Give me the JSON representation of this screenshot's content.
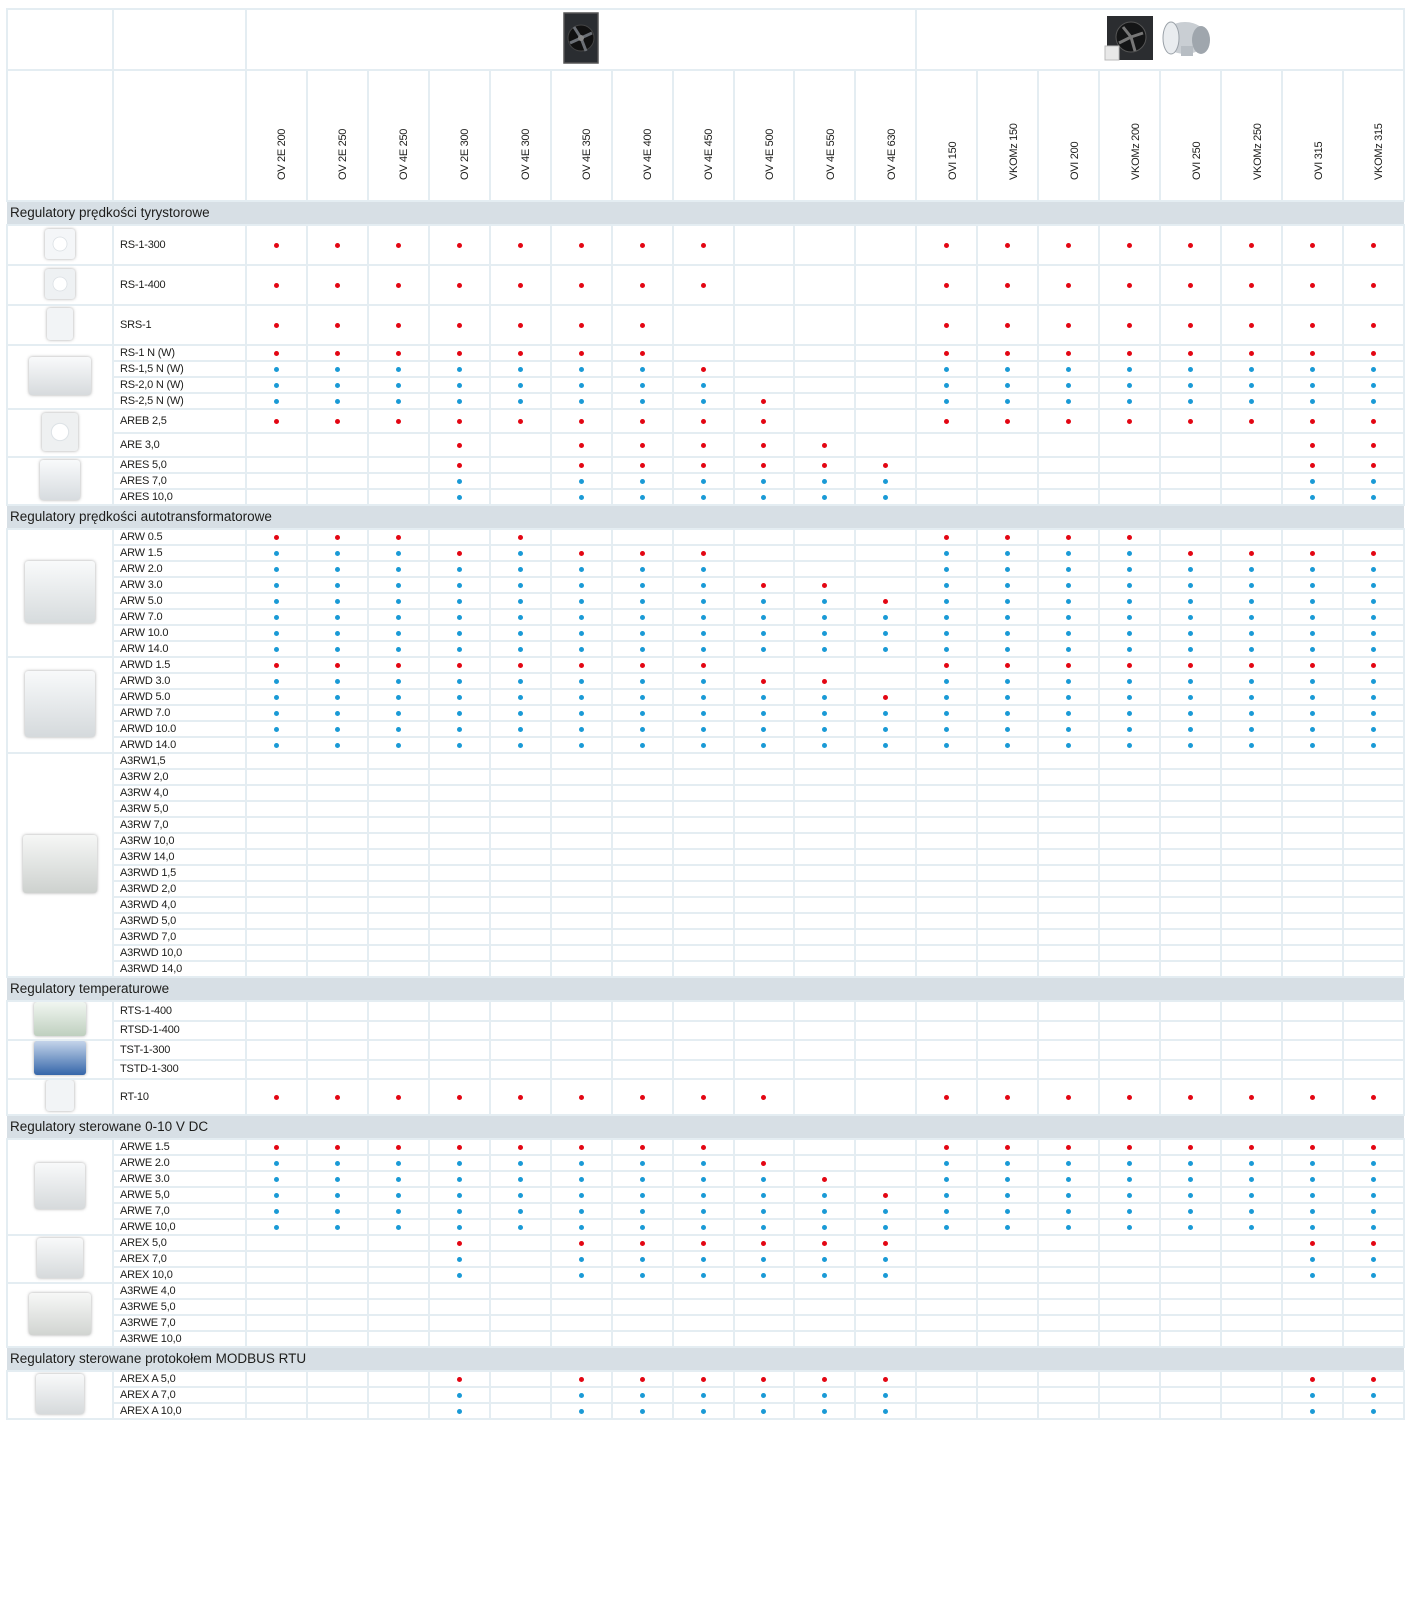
{
  "columns": [
    "OV 2E 200",
    "OV 2E 250",
    "OV 4E 250",
    "OV 2E 300",
    "OV 4E 300",
    "OV 4E 350",
    "OV 4E 400",
    "OV 4E 450",
    "OV 4E 500",
    "OV 4E 550",
    "OV 4E 630",
    "OVI 150",
    "VKOMz 150",
    "OVI 200",
    "VKOMz 200",
    "OVI 250",
    "VKOMz 250",
    "OVI 315",
    "VKOMz 315"
  ],
  "header_images": [
    {
      "icon": "wall-fan-image",
      "span": 11
    },
    {
      "icon": "inline-fan-image",
      "span": 8
    }
  ],
  "colors": {
    "red": "#e30613",
    "blue": "#1a9ad6",
    "section_bg": "#d7dfe5",
    "grid": "#e4edf2"
  },
  "sections": [
    {
      "title": "Regulatory prędkości tyrystorowe",
      "groups": [
        {
          "icon": "rs-1-300-controller-image",
          "rowh": 40,
          "rows": [
            {
              "name": "RS-1-300",
              "pattern": "RRRRRRRR---RRRRRRRR"
            }
          ]
        },
        {
          "icon": "rs-1-400-controller-image",
          "rowh": 40,
          "rows": [
            {
              "name": "RS-1-400",
              "pattern": "RRRRRRRR---RRRRRRRR"
            }
          ]
        },
        {
          "icon": "srs-1-controller-image",
          "rowh": 40,
          "rows": [
            {
              "name": "SRS-1",
              "pattern": "RRRRRRR----RRRRRRRR"
            }
          ]
        },
        {
          "icon": "rs-n-controller-image",
          "rowh": 16,
          "rows": [
            {
              "name": "RS-1 N (W)",
              "pattern": "RRRRRRR----RRRRRRRR"
            },
            {
              "name": "RS-1,5 N (W)",
              "pattern": "BBBBBBBR---BBBBBBBB"
            },
            {
              "name": "RS-2,0 N (W)",
              "pattern": "BBBBBBBB---BBBBBBBB"
            },
            {
              "name": "RS-2,5 N (W)",
              "pattern": "BBBBBBBBR--BBBBBBBB"
            }
          ]
        },
        {
          "icon": "areb-controller-image",
          "rowh": 24,
          "rows": [
            {
              "name": "AREB 2,5",
              "pattern": "RRRRRRRRR--RRRRRRRR"
            },
            {
              "name": "ARE 3,0",
              "pattern": "---R-RRRRR-------RR"
            }
          ]
        },
        {
          "icon": "ares-controller-image",
          "rowh": 16,
          "rows": [
            {
              "name": "ARES 5,0",
              "pattern": "---R-RRRRRR------RR"
            },
            {
              "name": "ARES 7,0",
              "pattern": "---B-BBBBBB------BB"
            },
            {
              "name": "ARES 10,0",
              "pattern": "---B-BBBBBB------BB"
            }
          ]
        }
      ]
    },
    {
      "title": "Regulatory prędkości autotransformatorowe",
      "groups": [
        {
          "icon": "arw-controller-image",
          "rowh": 16,
          "rows": [
            {
              "name": "ARW 0.5",
              "pattern": "RRR-R------RRRR----"
            },
            {
              "name": "ARW 1.5",
              "pattern": "BBBRBRRR---BBBBRRRR"
            },
            {
              "name": "ARW 2.0",
              "pattern": "BBBBBBBB---BBBBBBBB"
            },
            {
              "name": "ARW 3.0",
              "pattern": "BBBBBBBBRR-BBBBBBBB"
            },
            {
              "name": "ARW 5.0",
              "pattern": "BBBBBBBBBBRBBBBBBBB"
            },
            {
              "name": "ARW 7.0",
              "pattern": "BBBBBBBBBBBBBBBBBBB"
            },
            {
              "name": "ARW 10.0",
              "pattern": "BBBBBBBBBBBBBBBBBBB"
            },
            {
              "name": "ARW 14.0",
              "pattern": "BBBBBBBBBBBBBBBBBBB"
            }
          ]
        },
        {
          "icon": "arwd-controller-image",
          "rowh": 16,
          "rows": [
            {
              "name": "ARWD 1.5",
              "pattern": "RRRRRRRR---RRRRRRRR"
            },
            {
              "name": "ARWD 3.0",
              "pattern": "BBBBBBBBRR-BBBBBBBB"
            },
            {
              "name": "ARWD 5.0",
              "pattern": "BBBBBBBBBBRBBBBBBBB"
            },
            {
              "name": "ARWD 7.0",
              "pattern": "BBBBBBBBBBBBBBBBBBB"
            },
            {
              "name": "ARWD 10.0",
              "pattern": "BBBBBBBBBBBBBBBBBBB"
            },
            {
              "name": "ARWD 14.0",
              "pattern": "BBBBBBBBBBBBBBBBBBB"
            }
          ]
        },
        {
          "icon": "a3rw-controller-image",
          "rowh": 16,
          "rows": [
            {
              "name": "A3RW1,5",
              "pattern": "-------------------"
            },
            {
              "name": "A3RW 2,0",
              "pattern": "-------------------"
            },
            {
              "name": "A3RW 4,0",
              "pattern": "-------------------"
            },
            {
              "name": "A3RW 5,0",
              "pattern": "-------------------"
            },
            {
              "name": "A3RW 7,0",
              "pattern": "-------------------"
            },
            {
              "name": "A3RW 10,0",
              "pattern": "-------------------"
            },
            {
              "name": "A3RW 14,0",
              "pattern": "-------------------"
            },
            {
              "name": "A3RWD 1,5",
              "pattern": "-------------------"
            },
            {
              "name": "A3RWD 2,0",
              "pattern": "-------------------"
            },
            {
              "name": "A3RWD 4,0",
              "pattern": "-------------------"
            },
            {
              "name": "A3RWD 5,0",
              "pattern": "-------------------"
            },
            {
              "name": "A3RWD 7,0",
              "pattern": "-------------------"
            },
            {
              "name": "A3RWD 10,0",
              "pattern": "-------------------"
            },
            {
              "name": "A3RWD 14,0",
              "pattern": "-------------------"
            }
          ]
        }
      ]
    },
    {
      "title": "Regulatory temperaturowe",
      "groups": [
        {
          "icon": "rts-controller-image",
          "rowh": 19,
          "rows": [
            {
              "name": "RTS-1-400",
              "pattern": "-------------------"
            },
            {
              "name": "RTSD-1-400",
              "pattern": "-------------------"
            }
          ]
        },
        {
          "icon": "tst-controller-image",
          "rowh": 19,
          "rows": [
            {
              "name": "TST-1-300",
              "pattern": "-------------------"
            },
            {
              "name": "TSTD-1-300",
              "pattern": "-------------------"
            }
          ]
        },
        {
          "icon": "rt-10-controller-image",
          "rowh": 35,
          "rows": [
            {
              "name": "RT-10",
              "pattern": "RRRRRRRRR--RRRRRRRR"
            }
          ]
        }
      ]
    },
    {
      "title": "Regulatory sterowane 0-10 V DC",
      "groups": [
        {
          "icon": "arwe-controller-image",
          "rowh": 16,
          "rows": [
            {
              "name": "ARWE 1.5",
              "pattern": "RRRRRRRR---RRRRRRRR"
            },
            {
              "name": "ARWE 2.0",
              "pattern": "BBBBBBBBR--BBBBBBBB"
            },
            {
              "name": "ARWE 3.0",
              "pattern": "BBBBBBBBBR-BBBBBBBB"
            },
            {
              "name": "ARWE 5,0",
              "pattern": "BBBBBBBBBBRBBBBBBBB"
            },
            {
              "name": "ARWE 7,0",
              "pattern": "BBBBBBBBBBBBBBBBBBB"
            },
            {
              "name": "ARWE 10,0",
              "pattern": "BBBBBBBBBBBBBBBBBBB"
            }
          ]
        },
        {
          "icon": "arex-controller-image",
          "rowh": 16,
          "rows": [
            {
              "name": "AREX 5,0",
              "pattern": "---R-RRRRRR------RR"
            },
            {
              "name": "AREX 7,0",
              "pattern": "---B-BBBBBB------BB"
            },
            {
              "name": "AREX 10,0",
              "pattern": "---B-BBBBBB------BB"
            }
          ]
        },
        {
          "icon": "a3rwe-controller-image",
          "rowh": 16,
          "rows": [
            {
              "name": "A3RWE 4,0",
              "pattern": "-------------------"
            },
            {
              "name": "A3RWE 5,0",
              "pattern": "-------------------"
            },
            {
              "name": "A3RWE 7,0",
              "pattern": "-------------------"
            },
            {
              "name": "A3RWE 10,0",
              "pattern": "-------------------"
            }
          ]
        }
      ]
    },
    {
      "title": "Regulatory sterowane protokołem MODBUS RTU",
      "groups": [
        {
          "icon": "arex-a-controller-image",
          "rowh": 16,
          "rows": [
            {
              "name": "AREX A 5,0",
              "pattern": "---R-RRRRRR------RR"
            },
            {
              "name": "AREX A 7,0",
              "pattern": "---B-BBBBBB------BB"
            },
            {
              "name": "AREX A 10,0",
              "pattern": "---B-BBBBBB------BB"
            }
          ]
        }
      ]
    }
  ]
}
